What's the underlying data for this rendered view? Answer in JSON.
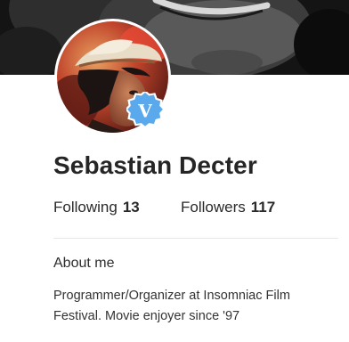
{
  "profile": {
    "name": "Sebastian Decter",
    "verified_badge_letter": "V",
    "verified_badge_color": "#5aa9ec",
    "stats": {
      "following_label": "Following",
      "following_count": "13",
      "followers_label": "Followers",
      "followers_count": "117"
    },
    "about": {
      "heading": "About me",
      "text": "Programmer/Organizer at Insomniac Film Festival. Movie enjoyer since '97"
    }
  },
  "icons": {
    "badge": "verified-badge-icon",
    "avatar": "profile-photo",
    "cover": "cover-photo"
  }
}
